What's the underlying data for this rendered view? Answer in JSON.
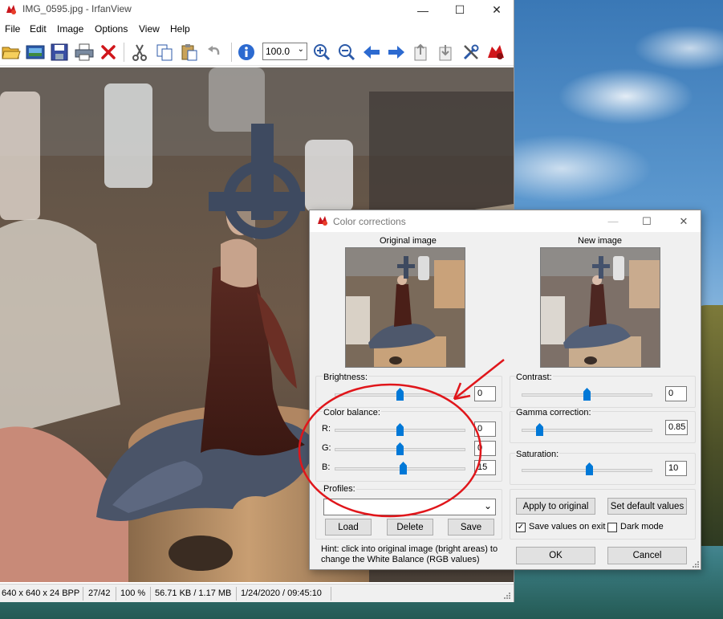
{
  "main_window": {
    "title": "IMG_0595.jpg - IrfanView",
    "menu": [
      "File",
      "Edit",
      "Image",
      "Options",
      "View",
      "Help"
    ],
    "toolbar_icons": [
      "open-folder-icon",
      "thumbnails-icon",
      "save-icon",
      "print-icon",
      "delete-icon",
      "cut-icon",
      "copy-icon",
      "paste-icon",
      "undo-icon",
      "info-icon",
      "zoom-in-icon",
      "zoom-out-icon",
      "previous-icon",
      "next-icon",
      "copy-to-icon",
      "move-to-icon",
      "settings-icon",
      "irfanview-logo-icon"
    ],
    "zoom_value": "100.0",
    "status": {
      "dimensions": "640 x 640 x 24 BPP",
      "index": "27/42",
      "zoom": "100 %",
      "size": "56.71 KB / 1.17 MB",
      "datetime": "1/24/2020 / 09:45:10"
    }
  },
  "dialog": {
    "title": "Color corrections",
    "original_label": "Original image",
    "new_label": "New image",
    "brightness": {
      "label": "Brightness:",
      "value": "0",
      "level": 0.5
    },
    "color_balance": {
      "label": "Color balance:",
      "r": {
        "label": "R:",
        "value": "0",
        "level": 0.5
      },
      "g": {
        "label": "G:",
        "value": "0",
        "level": 0.5
      },
      "b": {
        "label": "B:",
        "value": "15",
        "level": 0.52
      }
    },
    "contrast": {
      "label": "Contrast:",
      "value": "0",
      "level": 0.5
    },
    "gamma": {
      "label": "Gamma correction:",
      "value": "0.85",
      "level": 0.14
    },
    "saturation": {
      "label": "Saturation:",
      "value": "10",
      "level": 0.52
    },
    "profiles": {
      "label": "Profiles:",
      "value": "",
      "load": "Load",
      "delete": "Delete",
      "save": "Save"
    },
    "apply_original": "Apply to original",
    "set_default": "Set default values",
    "save_values_label": "Save values on exit",
    "save_values_checked": true,
    "dark_mode_label": "Dark mode",
    "dark_mode_checked": false,
    "hint": "Hint: click into original image (bright areas) to change the White Balance (RGB values)",
    "ok": "OK",
    "cancel": "Cancel"
  },
  "colors": {
    "slider_accent": "#0078d7",
    "annotation_red": "#e0161b",
    "close_red": "#c42b1c"
  }
}
